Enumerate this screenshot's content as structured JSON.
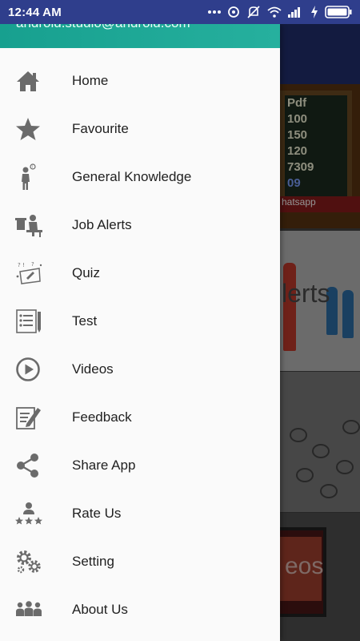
{
  "status_bar": {
    "time": "12:44 AM",
    "icons": [
      "more-dots-icon",
      "hotspot-icon",
      "mute-icon",
      "wifi-icon",
      "signal-icon",
      "charging-icon",
      "battery-icon"
    ]
  },
  "drawer": {
    "header_email": "android.studio@android.com",
    "header_color": "#1fa995",
    "items": [
      {
        "label": "Home",
        "icon": "home-icon"
      },
      {
        "label": "Favourite",
        "icon": "star-icon"
      },
      {
        "label": "General Knowledge",
        "icon": "thinker-icon"
      },
      {
        "label": "Job Alerts",
        "icon": "desk-worker-icon"
      },
      {
        "label": "Quiz",
        "icon": "quiz-icon"
      },
      {
        "label": "Test",
        "icon": "test-sheet-icon"
      },
      {
        "label": "Videos",
        "icon": "play-circle-icon"
      },
      {
        "label": "Feedback",
        "icon": "feedback-icon"
      },
      {
        "label": "Share App",
        "icon": "share-icon"
      },
      {
        "label": "Rate Us",
        "icon": "rate-us-icon"
      },
      {
        "label": "Setting",
        "icon": "gears-icon"
      },
      {
        "label": "About Us",
        "icon": "people-group-icon"
      }
    ]
  },
  "background": {
    "card1_lines": [
      "Pdf",
      "100",
      "150",
      "120",
      "7309",
      "09"
    ],
    "card1_strip": "hatsapp",
    "card2_text": "lerts",
    "card4_text": "eos"
  },
  "colors": {
    "status_bar": "#2f3e8c",
    "icon_gray": "#6b6b6b",
    "drawer_bg": "#fafafa"
  }
}
